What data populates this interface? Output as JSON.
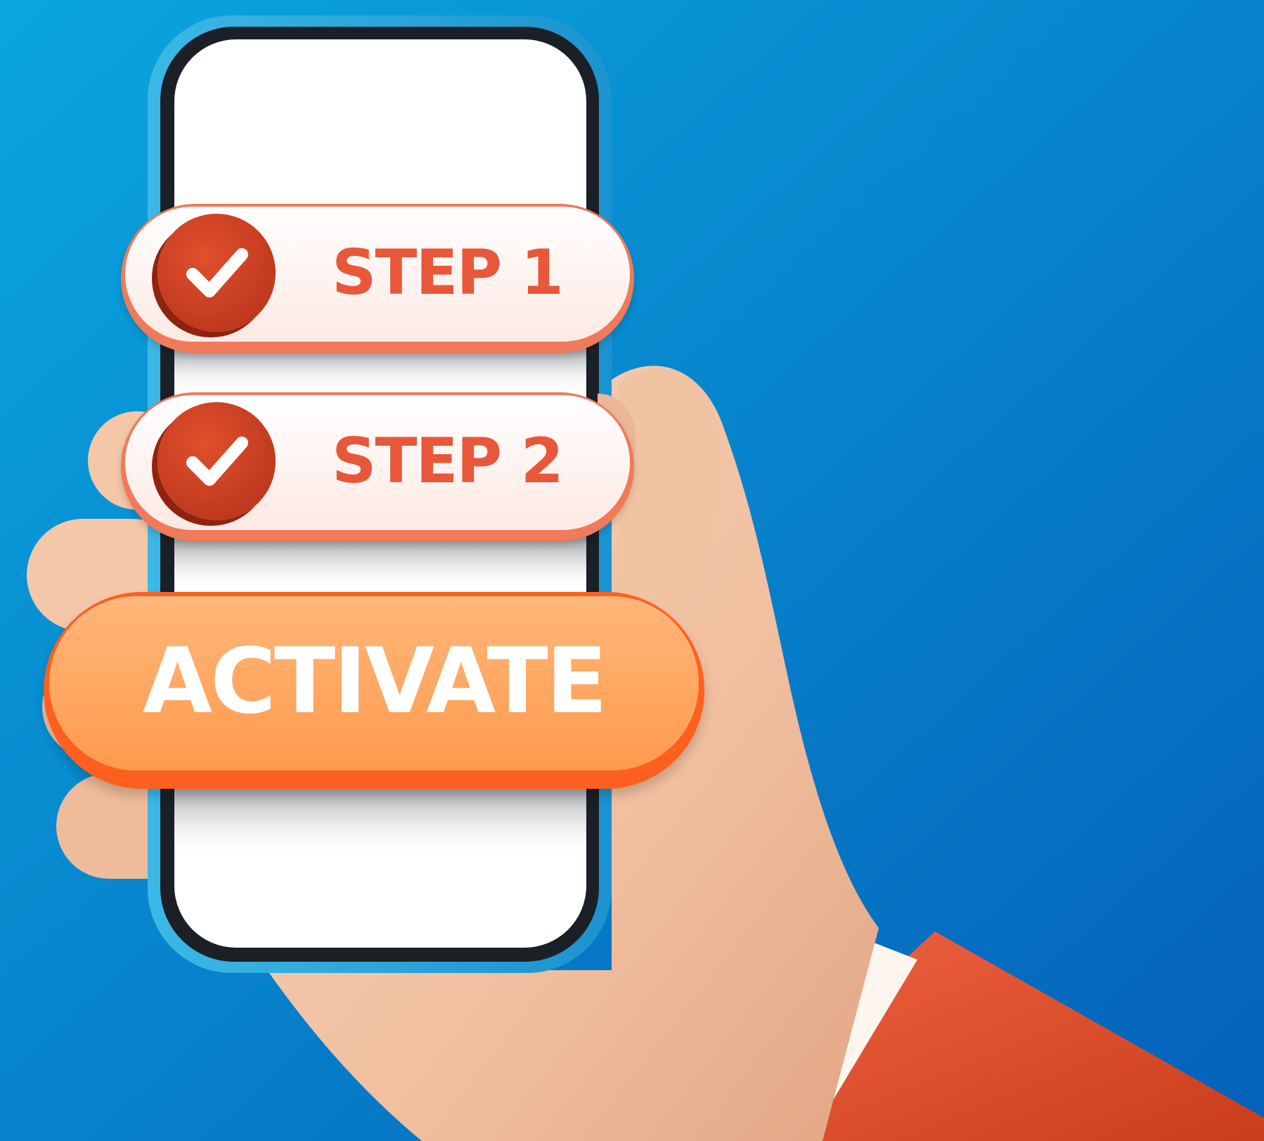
{
  "colors": {
    "background_top": "#0aa2dc",
    "background_bottom": "#0565bd",
    "phone_frame": "#2aa7d9",
    "phone_bezel": "#1a1f26",
    "screen": "#ffffff",
    "skin": "#f3c7a8",
    "skin_shadow": "#d99f7f",
    "sleeve": "#e2522d",
    "cuff": "#fff4ee",
    "step_pill": "#fff3ef",
    "step_border": "#f07a5a",
    "step_text": "#e8573a",
    "check_circle": "#c93a1c",
    "activate_fill": "#ffa863",
    "activate_border": "#ff5f1f",
    "activate_text": "#ffffff"
  },
  "steps": [
    {
      "label": "STEP 1",
      "checked": true,
      "icon": "checkmark-icon"
    },
    {
      "label": "STEP 2",
      "checked": true,
      "icon": "checkmark-icon"
    }
  ],
  "activate": {
    "label": "ACTIVATE"
  }
}
